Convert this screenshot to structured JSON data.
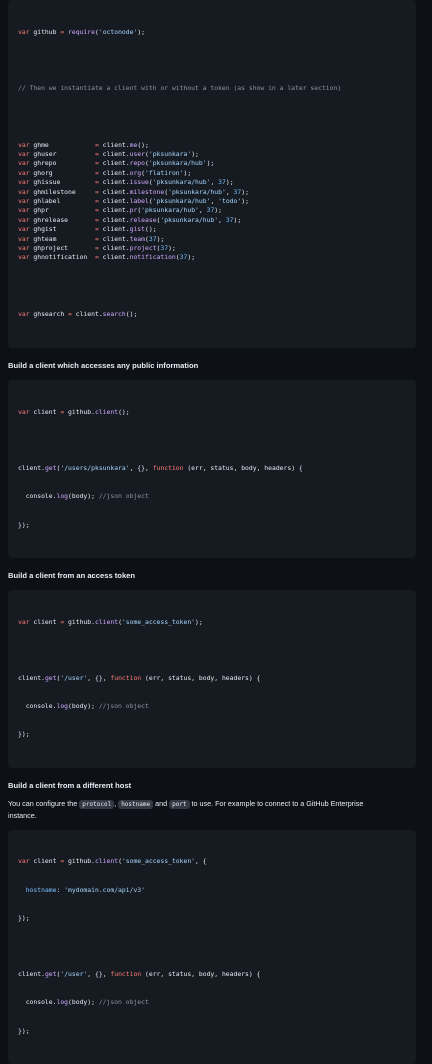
{
  "block1": {
    "require_line": [
      "var ",
      "github",
      " = ",
      "require",
      "(",
      "'octonode'",
      ");"
    ],
    "comment": "// Then we instantiate a client with or without a token (as show in a later section)",
    "assignments": [
      {
        "name": "ghme",
        "call": "client.me",
        "args": ""
      },
      {
        "name": "ghuser",
        "call": "client.user",
        "args": "'pksunkara'"
      },
      {
        "name": "ghrepo",
        "call": "client.repo",
        "args": "'pksunkara/hub'"
      },
      {
        "name": "ghorg",
        "call": "client.org",
        "args": "'flatiron'"
      },
      {
        "name": "ghissue",
        "call": "client.issue",
        "args": "'pksunkara/hub', 37"
      },
      {
        "name": "ghmilestone",
        "call": "client.milestone",
        "args": "'pksunkara/hub', 37"
      },
      {
        "name": "ghlabel",
        "call": "client.label",
        "args": "'pksunkara/hub', 'todo'"
      },
      {
        "name": "ghpr",
        "call": "client.pr",
        "args": "'pksunkara/hub', 37"
      },
      {
        "name": "ghrelease",
        "call": "client.release",
        "args": "'pksunkara/hub', 37"
      },
      {
        "name": "ghgist",
        "call": "client.gist",
        "args": ""
      },
      {
        "name": "ghteam",
        "call": "client.team",
        "args": "37"
      },
      {
        "name": "ghproject",
        "call": "client.project",
        "args": "37"
      },
      {
        "name": "ghnotification",
        "call": "client.notification",
        "args": "37"
      }
    ],
    "search_line": "var ghsearch = client.search();"
  },
  "section_public": {
    "heading": "Build a client which accesses any public information",
    "line1": "var client = github.client();",
    "line2": "client.get('/users/pksunkara', {}, function (err, status, body, headers) {",
    "line3": "  console.log(body); //json object",
    "line4": "});"
  },
  "section_token": {
    "heading": "Build a client from an access token",
    "line1": "var client = github.client('some_access_token');",
    "line2": "client.get('/user', {}, function (err, status, body, headers) {",
    "line3": "  console.log(body); //json object",
    "line4": "});"
  },
  "section_host": {
    "heading": "Build a client from a different host",
    "para_before": "You can configure the",
    "code1": "protocol",
    "sep1": ",",
    "code2": "hostname",
    "sep2": "and",
    "code3": "port",
    "para_after": "to use. For example to connect to a GitHub Enterprise",
    "para_line2": "instance.",
    "line1": "var client = github.client('some_access_token', {",
    "line2": "  hostname: 'mydomain.com/api/v3'",
    "line3": "});",
    "line4": "client.get('/user', {}, function (err, status, body, headers) {",
    "line5": "  console.log(body); //json object",
    "line6": "});"
  },
  "colors": {
    "background": "#0d1117",
    "code_bg": "#161b22",
    "keyword": "#ff7b72",
    "function": "#d2a8ff",
    "string": "#a5d6ff",
    "comment": "#8b949e"
  }
}
